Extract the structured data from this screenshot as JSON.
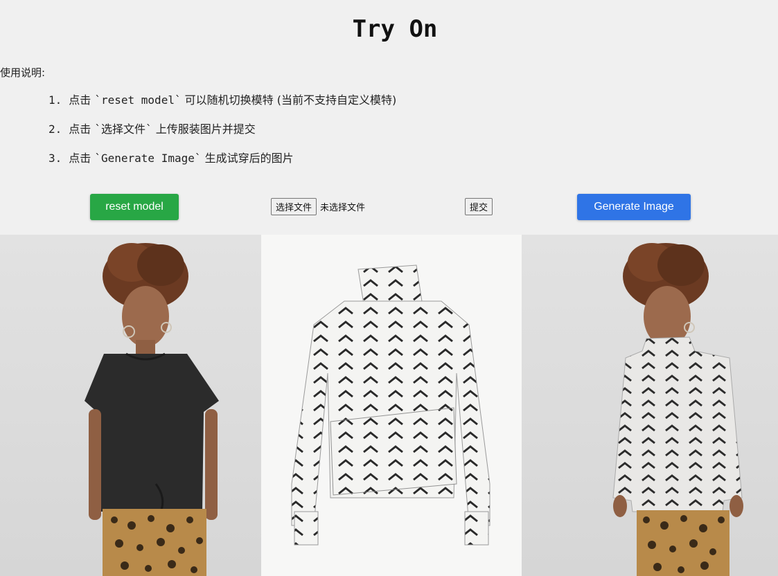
{
  "page": {
    "title": "Try On"
  },
  "instructions": {
    "label": "使用说明:",
    "steps": [
      {
        "num": "1.",
        "pre": "点击 ",
        "code": "`reset model`",
        "post": " 可以随机切换模特 (当前不支持自定义模特)"
      },
      {
        "num": "2.",
        "pre": "点击 ",
        "code": "`选择文件`",
        "post": " 上传服装图片并提交"
      },
      {
        "num": "3.",
        "pre": "点击 ",
        "code": "`Generate Image`",
        "post": " 生成试穿后的图片"
      }
    ]
  },
  "controls": {
    "reset_label": "reset model",
    "choose_file_label": "选择文件",
    "file_status": "未选择文件",
    "submit_label": "提交",
    "generate_label": "Generate Image"
  },
  "colors": {
    "reset_button": "#28a745",
    "generate_button": "#2f74e6",
    "background": "#f0f0f0"
  },
  "images": {
    "model": "model-photo",
    "garment": "garment-photo",
    "result": "tryon-result-photo"
  }
}
